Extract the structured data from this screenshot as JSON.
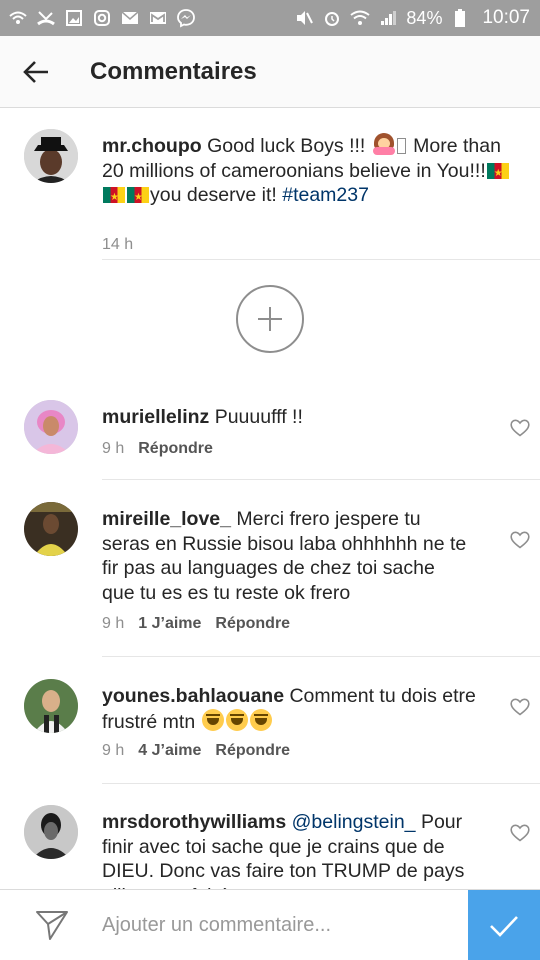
{
  "status_bar": {
    "battery": "84%",
    "time": "10:07"
  },
  "header": {
    "title": "Commentaires"
  },
  "caption": {
    "username": "mr.choupo",
    "text_1": "Good luck Boys !!! ",
    "text_2": " More than 20 millions of cameroonians believe in You!!!",
    "text_3": "you deserve it! ",
    "hashtag": "#team237",
    "time": "14 h"
  },
  "comments": [
    {
      "username": "muriellelinz",
      "text": "Puuuufff !!",
      "time": "9 h",
      "likes": "",
      "reply": "Répondre"
    },
    {
      "username": "mireille_love_",
      "text": "Merci frero jespere tu seras en Russie bisou laba ohhhhhh ne te fir pas au languages de chez toi sache que tu es es tu reste ok frero",
      "time": "9 h",
      "likes": "1 J’aime",
      "reply": "Répondre"
    },
    {
      "username": "younes.bahlaouane",
      "text": "Comment tu dois etre frustré mtn ",
      "time": "9 h",
      "likes": "4 J’aime",
      "reply": "Répondre"
    },
    {
      "username": "mrsdorothywilliams",
      "mention": "@belingstein_",
      "text": "Pour finir avec toi sache que je crains que de DIEU. Donc vas faire ton TRUMP de pays ailleurs enfoiré"
    }
  ],
  "composer": {
    "placeholder": "Ajouter un commentaire..."
  },
  "icons": {
    "back": "arrow-left-icon",
    "load_more": "plus-circle-icon",
    "like": "heart-outline-icon",
    "send": "paper-plane-icon",
    "post": "check-icon"
  },
  "colors": {
    "post_button": "#4aa3ea",
    "hashtag": "#003569",
    "status_bar": "#9e9e9e"
  }
}
